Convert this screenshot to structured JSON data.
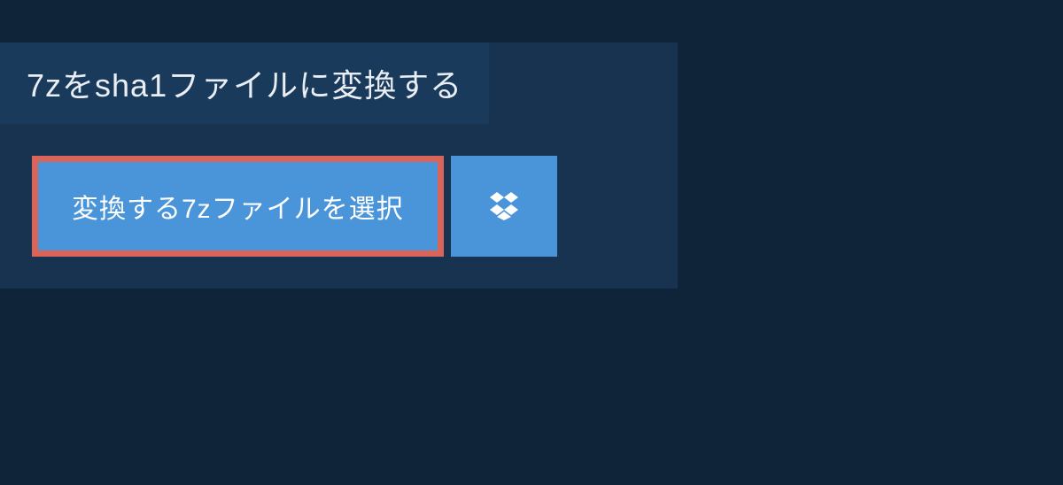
{
  "title": "7zをsha1ファイルに変換する",
  "buttons": {
    "select_file": "変換する7zファイルを選択"
  },
  "icons": {
    "dropbox": "dropbox-icon"
  },
  "colors": {
    "background": "#0f2438",
    "panel": "#183350",
    "title_bg": "#1a3a5c",
    "button_bg": "#4a95d9",
    "button_border": "#d96459",
    "text_light": "#e8eef3"
  }
}
